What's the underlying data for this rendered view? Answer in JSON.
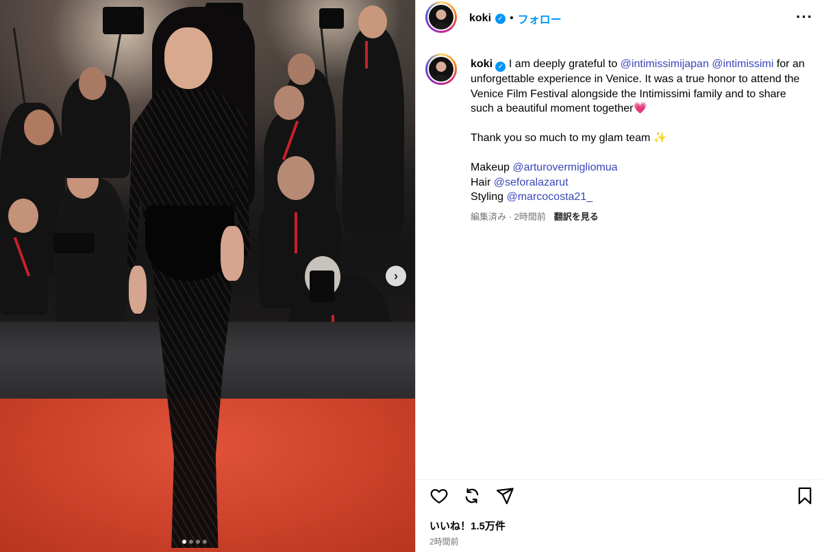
{
  "post": {
    "username": "koki",
    "follow_label": "フォロー",
    "bullet": "•",
    "verified_icon": "verified-badge-icon",
    "more_icon": "more-options-icon"
  },
  "caption": {
    "username": "koki",
    "intro": " I am deeply grateful to ",
    "mention1": "@intimissimijapan",
    "space": " ",
    "mention2": "@intimissimi",
    "body": " for an unforgettable experience in Venice. It was a true honor to attend the Venice Film Festival alongside the Intimissimi family and to share such a beautiful moment together",
    "heart": "💗",
    "thanks": "Thank you so much to my glam team ",
    "sparkle": "✨",
    "makeup_label": "Makeup ",
    "makeup_mention": "@arturovermigliomua",
    "hair_label": "Hair ",
    "hair_mention": "@seforalazarut",
    "styling_label": "Styling ",
    "styling_mention": "@marcocosta21_"
  },
  "meta": {
    "edited": "編集済み · 2時間前",
    "translate": "翻訳を見る"
  },
  "engagement": {
    "likes": "いいね！1.5万件",
    "time": "2時間前"
  },
  "media": {
    "carousel_total": 4,
    "carousel_active": 1,
    "next_icon": "chevron-right-icon"
  },
  "colors": {
    "link": "#3847b9",
    "follow": "#0095f6",
    "muted": "#737373",
    "carpet": "#d2492f"
  }
}
